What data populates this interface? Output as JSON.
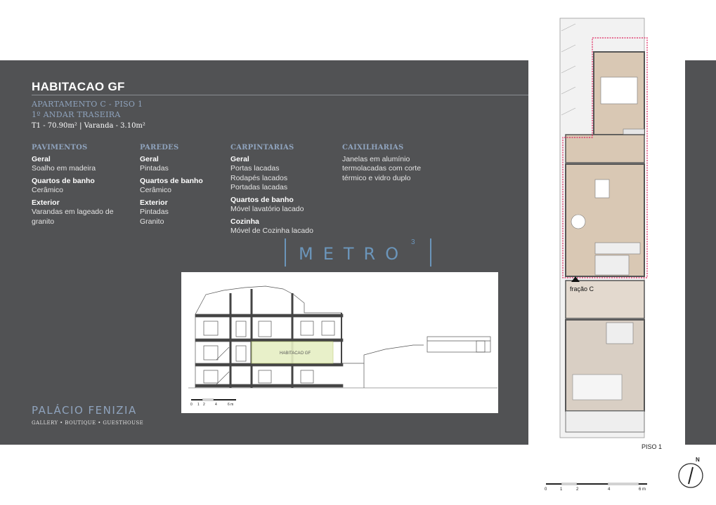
{
  "header": {
    "title": "HABITACAO GF",
    "subtitle_1": "APARTAMENTO C - PISO 1",
    "subtitle_2": "1º ANDAR TRASEIRA",
    "area": "T1 - 70.90m² | Varanda - 3.10m²"
  },
  "specs": {
    "pavimentos": {
      "heading": "PAVIMENTOS",
      "items": [
        {
          "label": "Geral",
          "value": "Soalho em madeira"
        },
        {
          "label": "Quartos de banho",
          "value": "Cerâmico"
        },
        {
          "label": "Exterior",
          "value": "Varandas em lageado de granito"
        }
      ]
    },
    "paredes": {
      "heading": "PAREDES",
      "items": [
        {
          "label": "Geral",
          "value": "Pintadas"
        },
        {
          "label": "Quartos de banho",
          "value": "Cerâmico"
        },
        {
          "label": "Exterior",
          "value": "Pintadas"
        }
      ],
      "extra_value": "Granito"
    },
    "carpintarias": {
      "heading": "CARPINTARIAS",
      "items": [
        {
          "label": "Geral",
          "values": [
            "Portas lacadas",
            "Rodapés lacados",
            "Portadas lacadas"
          ]
        },
        {
          "label": "Quartos de banho",
          "values": [
            "Móvel lavatório lacado"
          ]
        },
        {
          "label": "Cozinha",
          "values": [
            "Móvel de Cozinha lacado"
          ]
        }
      ]
    },
    "caixilharias": {
      "heading": "CAIXILHARIAS",
      "text": "Janelas em alumínio termolacadas com corte térmico e vidro duplo"
    }
  },
  "logo": {
    "text": "METRO",
    "superscript": "3"
  },
  "brand": {
    "name": "PALÁCIO FENIZIA",
    "tagline": "GALLERY • BOUTIQUE • GUESTHOUSE"
  },
  "section_drawing": {
    "highlight_label": "HABITACAO GF",
    "highlight_color": "#e6efc4",
    "scale_labels": [
      "0",
      "1",
      "2",
      "4",
      "6 m"
    ]
  },
  "floor_plan": {
    "unit_label": "fração C",
    "floor_label": "PISO 1",
    "highlight_color": "#e0245e",
    "scale_labels": [
      "0",
      "1",
      "2",
      "4",
      "6 m"
    ],
    "north_label": "N"
  },
  "colors": {
    "panel": "#515254",
    "accent_blue": "#8fa3bd",
    "wood": "#d9c8b4"
  }
}
